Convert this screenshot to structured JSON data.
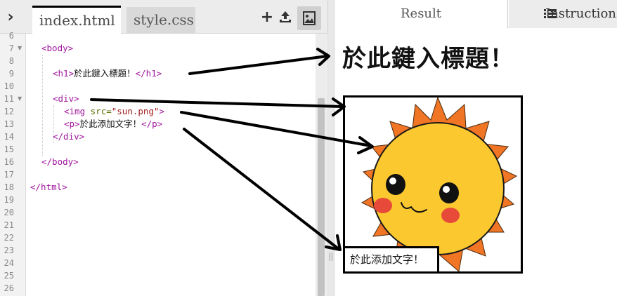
{
  "editor": {
    "collapse_icon": "chevron-right-icon",
    "tabs": [
      {
        "label": "index.html",
        "active": true
      },
      {
        "label": "style.css",
        "active": false
      }
    ],
    "toolbar": {
      "add_icon": "plus-icon",
      "upload_icon": "upload-icon",
      "image_icon": "image-icon"
    },
    "line_numbers": [
      "6",
      "7",
      "8",
      "9",
      "10",
      "11",
      "12",
      "13",
      "14",
      "15",
      "16",
      "17",
      "18",
      "19",
      "20",
      "21",
      "22",
      "23",
      "24",
      "25",
      "26"
    ],
    "code": {
      "l7": "<body>",
      "l9_open": "<h1>",
      "l9_text": "於此鍵入標題！",
      "l9_close": "</h1>",
      "l11": "<div>",
      "l12_open": "<img ",
      "l12_attr": "src=",
      "l12_val": "\"sun.png\"",
      "l12_close": ">",
      "l13_open": "<p>",
      "l13_text": "於此添加文字！",
      "l13_close": "</p>",
      "l14": "</div>",
      "l16": "</body>",
      "l18": "</html>"
    }
  },
  "result": {
    "tabs": {
      "result_label": "Result",
      "instructions_label": "Instructions",
      "instructions_icon": "list-icon"
    },
    "heading": "於此鍵入標題！",
    "image_alt": "sun",
    "paragraph": "於此添加文字！"
  },
  "colors": {
    "tag": "#a0159c",
    "attr": "#5b6d00",
    "string": "#a11d1d",
    "sun_rays": "#f07524",
    "sun_face": "#fbc82f",
    "cheeks": "#e84a3a"
  }
}
